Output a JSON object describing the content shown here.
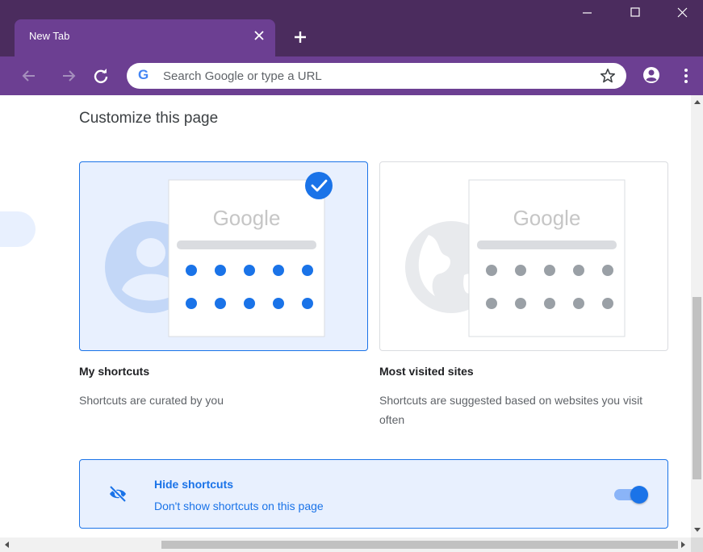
{
  "browser": {
    "tab_title": "New Tab",
    "omnibox_placeholder": "Search Google or type a URL",
    "google_g": "G"
  },
  "page": {
    "title": "Customize this page",
    "options": [
      {
        "title": "My shortcuts",
        "description": "Shortcuts are curated by you",
        "selected": true
      },
      {
        "title": "Most visited sites",
        "description": "Shortcuts are suggested based on websites you visit often",
        "selected": false
      }
    ],
    "preview_logo_text": "Google",
    "hide": {
      "title": "Hide shortcuts",
      "description": "Don't show shortcuts on this page",
      "toggle_on": true
    }
  },
  "colors": {
    "titlebar": "#4b2c5e",
    "toolbar": "#6c3f92",
    "accent": "#1a73e8",
    "selected_bg": "#e8f0fe"
  },
  "icons": [
    "close-icon",
    "plus-icon",
    "minimize-icon",
    "maximize-icon",
    "window-close-icon",
    "back-arrow-icon",
    "forward-arrow-icon",
    "reload-icon",
    "star-icon",
    "profile-icon",
    "more-vert-icon",
    "check-icon",
    "person-icon",
    "globe-icon",
    "eye-off-icon"
  ]
}
